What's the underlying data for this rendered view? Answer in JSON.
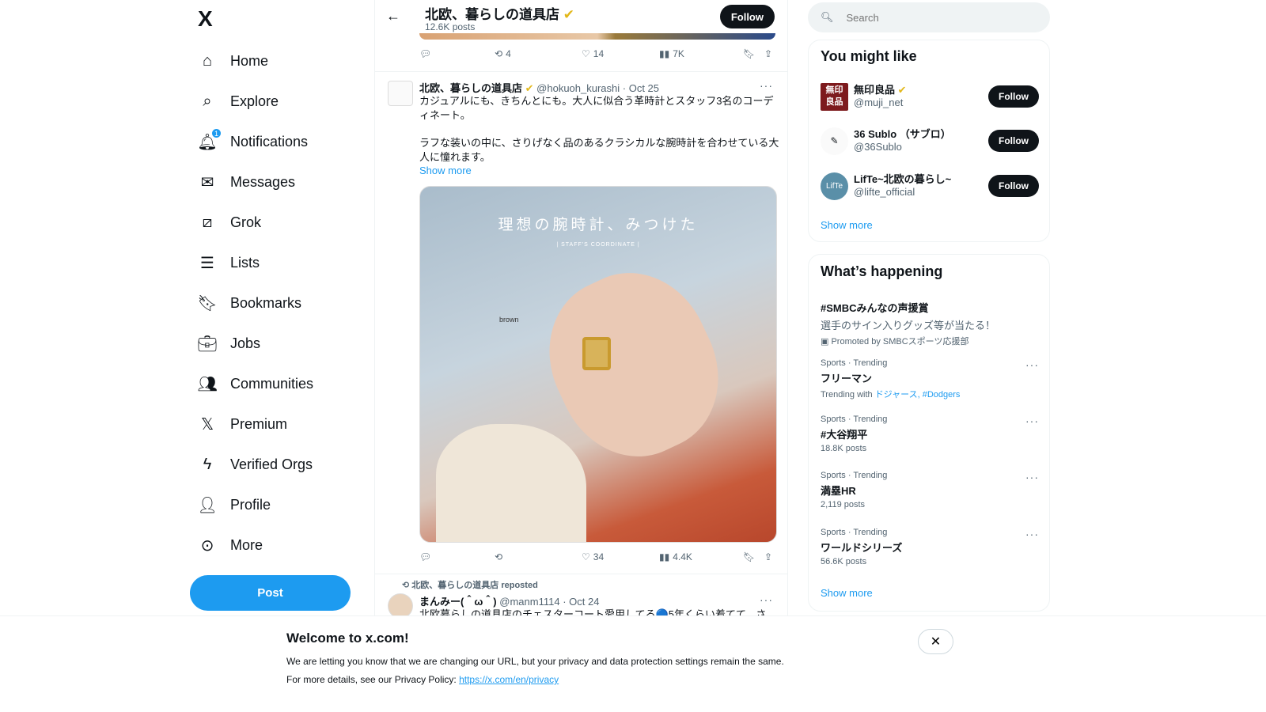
{
  "sidebar": {
    "logo": "X",
    "items": [
      {
        "label": "Home",
        "icon": "home-icon"
      },
      {
        "label": "Explore",
        "icon": "search-icon"
      },
      {
        "label": "Notifications",
        "icon": "bell-icon",
        "badge": "1"
      },
      {
        "label": "Messages",
        "icon": "envelope-icon"
      },
      {
        "label": "Grok",
        "icon": "grok-icon"
      },
      {
        "label": "Lists",
        "icon": "list-icon"
      },
      {
        "label": "Bookmarks",
        "icon": "bookmark-icon"
      },
      {
        "label": "Jobs",
        "icon": "briefcase-icon"
      },
      {
        "label": "Communities",
        "icon": "people-icon"
      },
      {
        "label": "Premium",
        "icon": "x-icon"
      },
      {
        "label": "Verified Orgs",
        "icon": "lightning-icon"
      },
      {
        "label": "Profile",
        "icon": "person-icon"
      },
      {
        "label": "More",
        "icon": "more-circle-icon"
      }
    ],
    "post_label": "Post"
  },
  "header": {
    "title": "北欧、暮らしの道具店",
    "posts": "12.6K posts",
    "follow": "Follow"
  },
  "tweet0": {
    "replies": "",
    "retweets": "4",
    "likes": "14",
    "views": "7K"
  },
  "tweet1": {
    "name": "北欧、暮らしの道具店",
    "handle": "@hokuoh_kurashi",
    "date": "· Oct 25",
    "text1": "カジュアルにも、きちんとにも。大人に似合う革時計とスタッフ3名のコーディネート。",
    "text2": "ラフな装いの中に、さりげなく品のあるクラシカルな腕時計を合わせている大人に憧れます。",
    "show_more": "Show more",
    "image_caption": "理想の腕時計、みつけた",
    "image_sub": "| STAFF'S COORDINATE |",
    "image_label": "brown",
    "retweets": "",
    "likes": "34",
    "views": "4.4K"
  },
  "tweet2": {
    "repost_by": "北欧、暮らしの道具店 reposted",
    "name": "まんみー(＾ω＾)",
    "handle": "@manm1114",
    "date": "· Oct 24",
    "text": "北欧暮らしの道具店のチェスターコート愛用してる🔵5年くらい着てて、さ"
  },
  "search": {
    "placeholder": "Search"
  },
  "you_might_like": {
    "title": "You might like",
    "users": [
      {
        "name": "無印良品",
        "handle": "@muji_net",
        "follow": "Follow",
        "verified": true,
        "avatar_text": "無印良品"
      },
      {
        "name": "36 Sublo （サブロ）",
        "handle": "@36Sublo",
        "follow": "Follow"
      },
      {
        "name": "LifTe~北欧の暮らし~",
        "handle": "@lifte_official",
        "follow": "Follow",
        "avatar_text": "LifTe"
      }
    ],
    "show_more": "Show more"
  },
  "happening": {
    "title": "What’s happening",
    "promoted": {
      "title": "#SMBCみんなの声援賞",
      "desc": "選手のサイン入りグッズ等が当たる！",
      "by": "Promoted by SMBCスポーツ応援部"
    },
    "trends": [
      {
        "context": "Sports · Trending",
        "title": "フリーマン",
        "meta": "Trending with",
        "links": "ドジャース, #Dodgers"
      },
      {
        "context": "Sports · Trending",
        "title": "#大谷翔平",
        "meta": "18.8K posts"
      },
      {
        "context": "Sports · Trending",
        "title": "満塁HR",
        "meta": "2,119 posts"
      },
      {
        "context": "Sports · Trending",
        "title": "ワールドシリーズ",
        "meta": "56.6K posts"
      }
    ],
    "show_more": "Show more"
  },
  "banner": {
    "title": "Welcome to x.com!",
    "line1": "We are letting you know that we are changing our URL, but your privacy and data protection settings remain the same.",
    "line2": "For more details, see our Privacy Policy:",
    "link": "https://x.com/en/privacy",
    "close": "✕"
  },
  "colors": {
    "accent": "#1d9bf0",
    "text": "#0f1419",
    "muted": "#536471",
    "verified": "#e2b719"
  }
}
